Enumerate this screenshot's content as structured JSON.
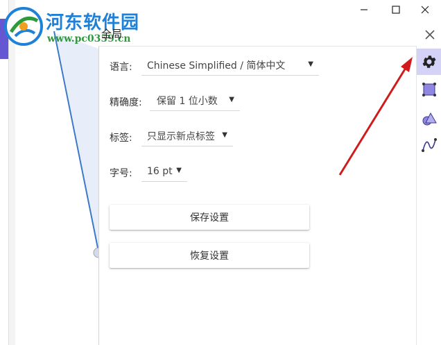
{
  "watermark": {
    "title": "河东软件园",
    "url": "www.pc0359.cn"
  },
  "window_controls": {
    "minimize_glyph": "—",
    "maximize_glyph": "☐",
    "close_glyph": "✕"
  },
  "global_tab": {
    "label": "全局"
  },
  "settings": {
    "language": {
      "label": "语言:",
      "value": "Chinese Simplified / 简体中文"
    },
    "precision": {
      "label": "精确度:",
      "value": "保留 1 位小数"
    },
    "labeling": {
      "label": "标签:",
      "value": "只显示新点标签"
    },
    "font_size": {
      "label": "字号:",
      "value": "16 pt"
    },
    "save_button": "保存设置",
    "restore_button": "恢复设置"
  },
  "toolbar": {
    "items": [
      "gear-icon",
      "polygon-icon",
      "shape-icon",
      "function-icon"
    ],
    "active": "gear-icon",
    "accent": "#6557d2",
    "active_bg": "#d4d2f6"
  },
  "colors": {
    "arrow": "#d11b1b",
    "line": "#3c78c8"
  }
}
